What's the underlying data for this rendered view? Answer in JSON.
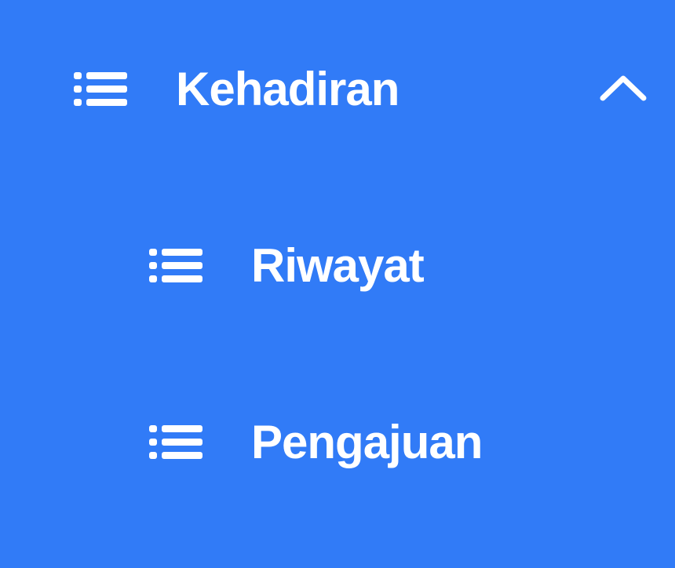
{
  "menu": {
    "parent": {
      "label": "Kehadiran",
      "icon": "list-icon",
      "expanded": true,
      "toggle_icon": "chevron-up-icon"
    },
    "children": [
      {
        "label": "Riwayat",
        "icon": "list-icon"
      },
      {
        "label": "Pengajuan",
        "icon": "list-icon"
      }
    ]
  },
  "colors": {
    "background": "#317bf7",
    "foreground": "#ffffff"
  }
}
